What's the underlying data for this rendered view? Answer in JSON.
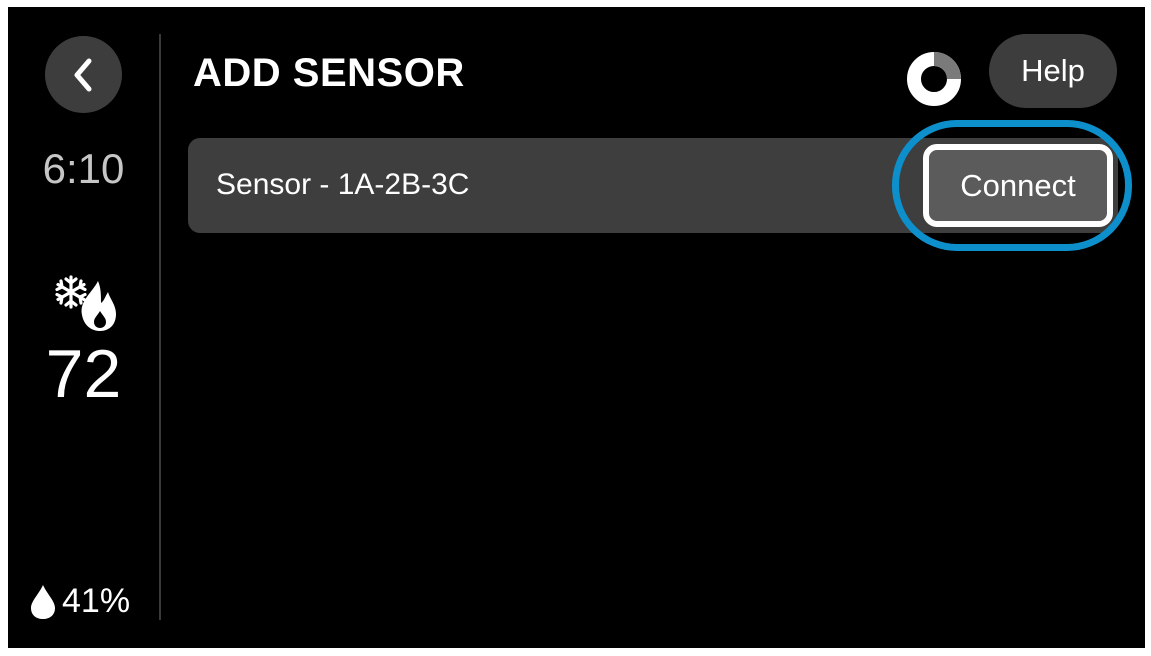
{
  "sidebar": {
    "time": "6:10",
    "mode_icon": "cool-heat-mode-icon",
    "temperature": "72",
    "humidity": "41%"
  },
  "header": {
    "title": "ADD SENSOR",
    "help_label": "Help",
    "back_icon": "chevron-left-icon",
    "spinner_icon": "loading-spinner-icon"
  },
  "sensors": [
    {
      "name": "Sensor - 1A-2B-3C",
      "action_label": "Connect"
    }
  ],
  "colors": {
    "background": "#000000",
    "button_bg": "#3d3d3d",
    "row_bg": "#3e3e3e",
    "connect_bg": "#5b5b5b",
    "highlight": "#0d8fcc",
    "time_text": "#c6c6c6"
  }
}
